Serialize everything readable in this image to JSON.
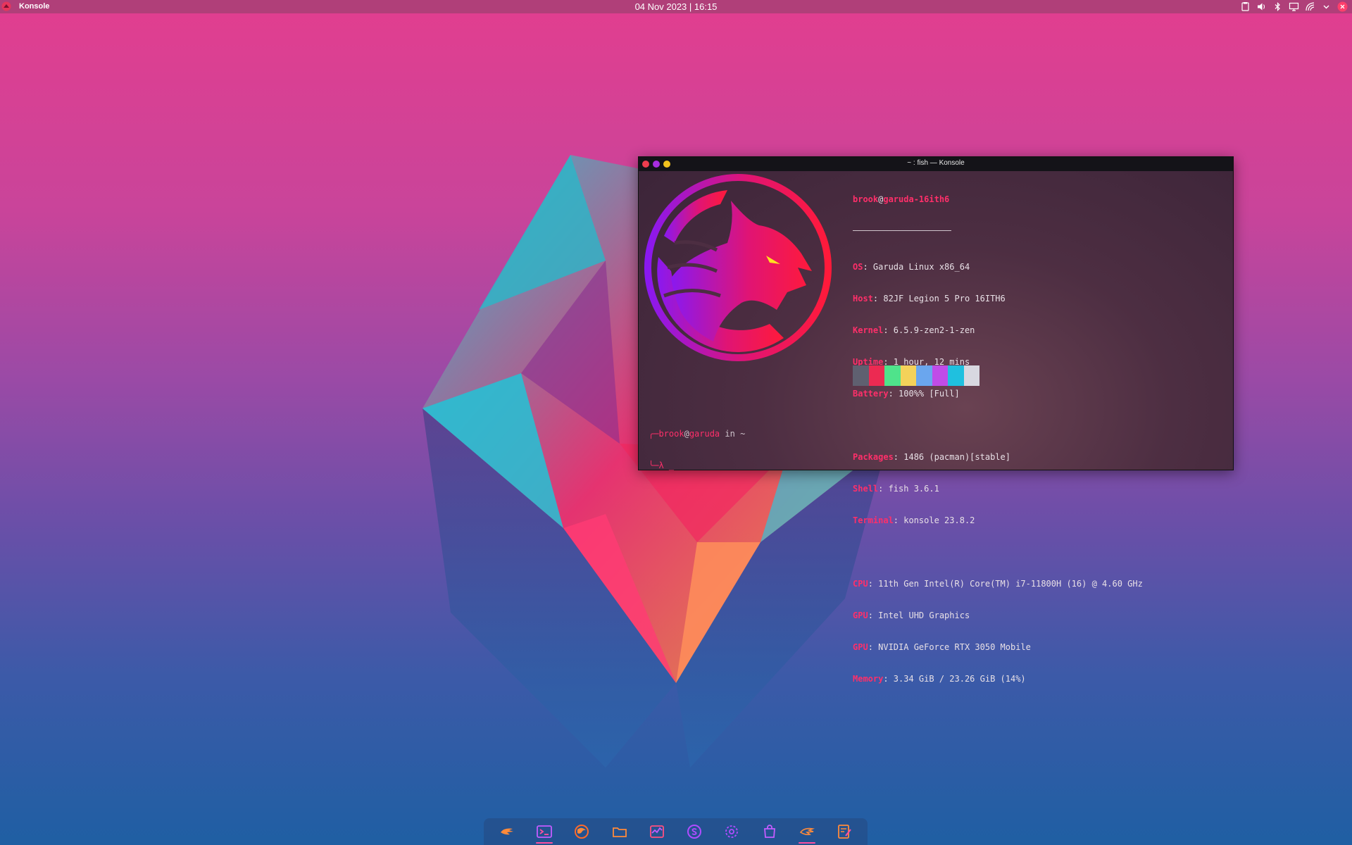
{
  "top_panel": {
    "app_name": "Konsole",
    "clock": "04 Nov 2023 | 16:15",
    "tray_icons": [
      "clipboard-icon",
      "volume-icon",
      "bluetooth-icon",
      "display-icon",
      "network-icon",
      "chevron-down-icon",
      "power-icon"
    ]
  },
  "konsole": {
    "title": "~ : fish — Konsole",
    "fetch": {
      "user": "brook",
      "at": "@",
      "host": "garuda-16ith6",
      "lines": [
        {
          "key": "OS",
          "value": ": Garuda Linux x86_64"
        },
        {
          "key": "Host",
          "value": ": 82JF Legion 5 Pro 16ITH6"
        },
        {
          "key": "Kernel",
          "value": ": 6.5.9-zen2-1-zen"
        },
        {
          "key": "Uptime",
          "value": ": 1 hour, 12 mins"
        },
        {
          "key": "Battery",
          "value": ": 100%% [Full]"
        }
      ],
      "lines2": [
        {
          "key": "Packages",
          "value": ": 1486 (pacman)[stable]"
        },
        {
          "key": "Shell",
          "value": ": fish 3.6.1"
        },
        {
          "key": "Terminal",
          "value": ": konsole 23.8.2"
        }
      ],
      "lines3": [
        {
          "key": "CPU",
          "value": ": 11th Gen Intel(R) Core(TM) i7-11800H (16) @ 4.60 GHz"
        },
        {
          "key": "GPU",
          "value": ": Intel UHD Graphics"
        },
        {
          "key": "GPU",
          "value": ": NVIDIA GeForce RTX 3050 Mobile"
        },
        {
          "key": "Memory",
          "value": ": 3.34 GiB / 23.26 GiB (14%)"
        }
      ],
      "palette": [
        "#5f6070",
        "#ec2a52",
        "#4fe38b",
        "#f4d25a",
        "#6aa6ee",
        "#c04ce8",
        "#1fc0df",
        "#d8d8e0"
      ]
    },
    "prompt": {
      "corner_top": "╭─",
      "user": "brook",
      "at": "@",
      "host": "garuda",
      "in": " in ",
      "dir": "~",
      "corner_bottom": "╰─",
      "symbol": "λ",
      "cursor": " _"
    }
  },
  "dock": {
    "items": [
      "garuda-welcome-icon",
      "terminal-icon",
      "firefox-icon",
      "file-manager-icon",
      "system-monitor-icon",
      "skype-icon",
      "settings-icon",
      "software-store-icon",
      "garuda-assistant-icon",
      "text-editor-icon"
    ]
  }
}
